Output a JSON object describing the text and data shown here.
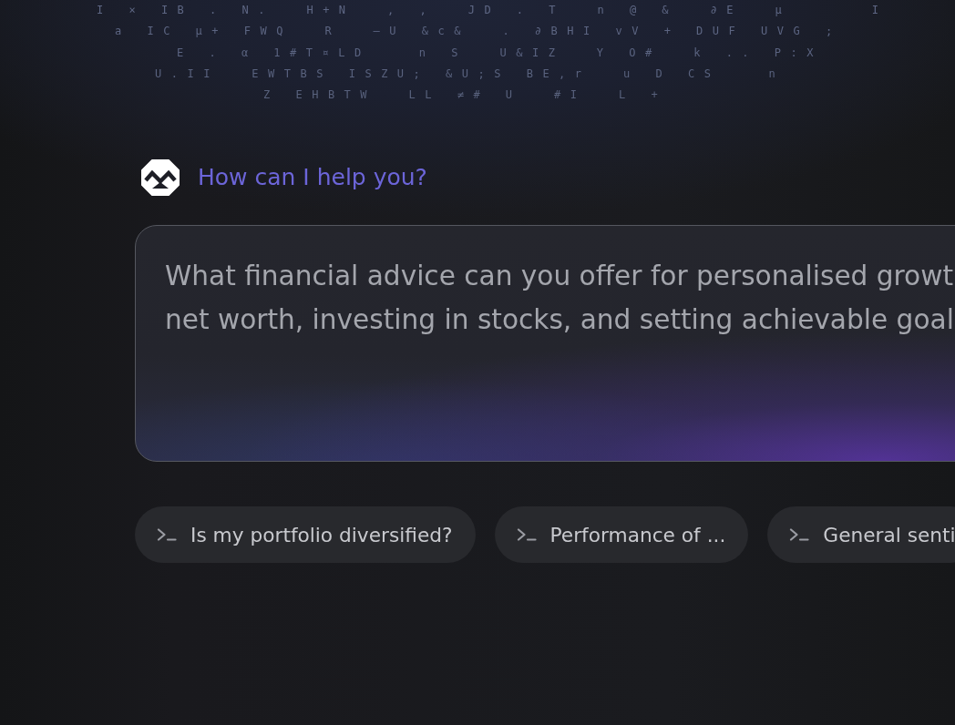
{
  "background_glyphs": [
    "I × IB . N.  H+N  , ,  JD . T  n @ &  ∂E  μ     I",
    "a IC μ+ FWQ  R  —U &c&  . ∂BHI vV + DUF UVG ;",
    "E . α 1#T¤LD   n S  U&IZ  Y O#  k .. P:X",
    "U.II  EWTBS ISZU; &U;S BE,r  u D CS   n",
    "Z EHBTW  LL ≠# U  #I  L +"
  ],
  "assistant": {
    "title": "How can I help you?"
  },
  "prompt": {
    "value": "What financial advice can you offer for personalised growt\nnet worth, investing in stocks, and setting achievable goal"
  },
  "suggestions": [
    {
      "label": "Is my portfolio diversified?"
    },
    {
      "label": "Performance of ..."
    },
    {
      "label": "General senti"
    }
  ]
}
